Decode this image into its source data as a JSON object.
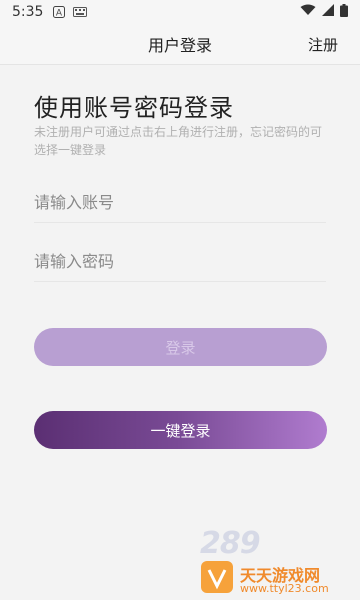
{
  "status_bar": {
    "time": "5:35",
    "icons": [
      "notification-a-icon",
      "keyboard-icon",
      "wifi-icon",
      "signal-icon",
      "battery-icon"
    ]
  },
  "header": {
    "title": "用户登录",
    "register_label": "注册"
  },
  "main": {
    "heading": "使用账号密码登录",
    "subtitle": "未注册用户可通过点击右上角进行注册，忘记密码的可选择一键登录",
    "account_placeholder": "请输入账号",
    "password_placeholder": "请输入密码",
    "login_button": "登录",
    "one_key_login_button": "一键登录"
  },
  "watermark": {
    "brand_number": "289",
    "site_name": "天天游戏网",
    "site_url": "www.ttyl23.com"
  },
  "colors": {
    "login_button": "#b89fd2",
    "one_key_gradient_start": "#5b2f73",
    "one_key_gradient_end": "#b07ccf",
    "watermark_orange": "#f08a2c"
  }
}
